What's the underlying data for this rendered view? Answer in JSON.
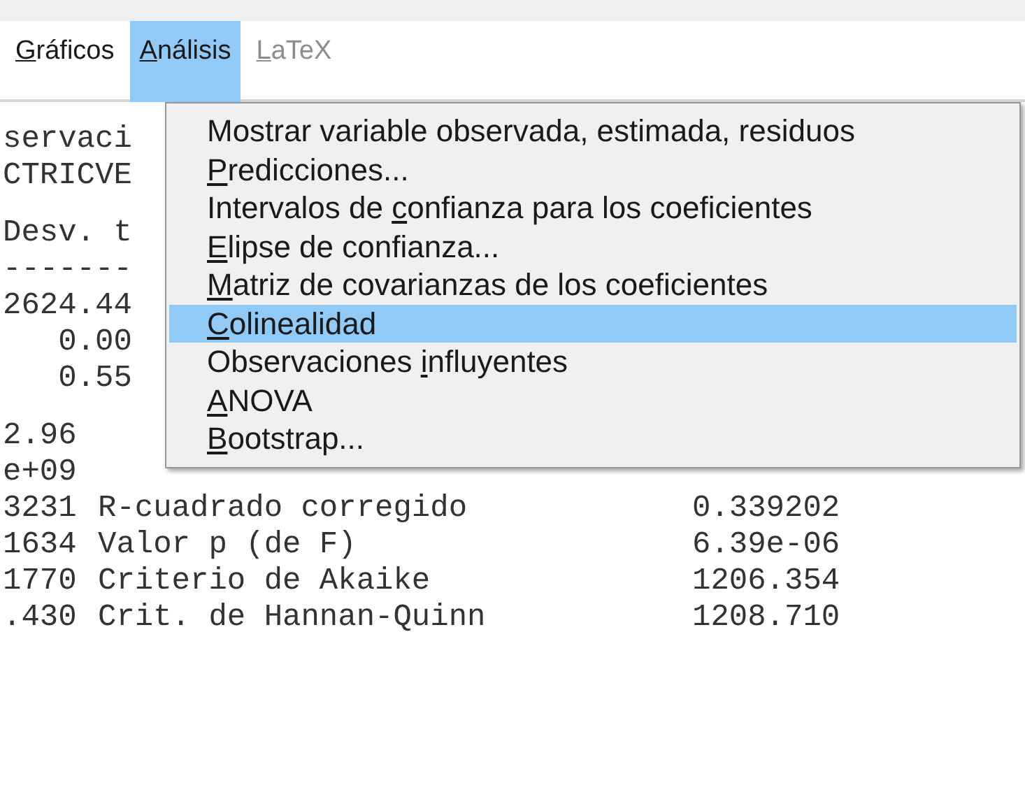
{
  "menubar": [
    {
      "label": {
        "key": "G",
        "after": "ráficos"
      },
      "selected": false,
      "disabled": false
    },
    {
      "label": {
        "key": "A",
        "after": "nálisis"
      },
      "selected": true,
      "disabled": false
    },
    {
      "label": {
        "key": "L",
        "after": "aTeX"
      },
      "selected": false,
      "disabled": true
    }
  ],
  "output": {
    "blocks": [
      {
        "lines": [
          "servaci",
          "CTRICVE"
        ]
      },
      {
        "lines": [
          "Desv. t",
          "-------",
          "2624.44",
          "   0.00",
          "   0.55"
        ]
      },
      {
        "lines": [
          "2.96",
          "e+09"
        ]
      }
    ],
    "rows": [
      {
        "col_1": "3231",
        "col_2": "R-cuadrado corregido",
        "col_3": "0.339202"
      },
      {
        "col_1": "1634",
        "col_2": "Valor p (de F)",
        "col_3": "6.39e-06"
      },
      {
        "col_1": "1770",
        "col_2": "Criterio de Akaike",
        "col_3": "1206.354"
      },
      {
        "col_1": ".430",
        "col_2": "Crit. de Hannan-Quinn",
        "col_3": "1208.710"
      }
    ]
  },
  "menu": {
    "items": [
      {
        "label": {
          "before": "Mostrar variable observada, estimada, residuos"
        },
        "selected": false
      },
      {
        "label": {
          "key": "P",
          "after": "redicciones..."
        },
        "selected": false
      },
      {
        "label": {
          "before": "Intervalos de ",
          "key": "c",
          "after": "onfianza para los coeficientes"
        },
        "selected": false
      },
      {
        "label": {
          "key": "E",
          "after": "lipse de confianza..."
        },
        "selected": false
      },
      {
        "label": {
          "key": "M",
          "after": "atriz de covarianzas de los coeficientes"
        },
        "selected": false
      },
      {
        "label": {
          "key": "C",
          "after": "olinealidad"
        },
        "selected": true
      },
      {
        "label": {
          "before": "Observaciones ",
          "key": "i",
          "after": "nfluyentes"
        },
        "selected": false
      },
      {
        "label": {
          "key": "A",
          "after": "NOVA"
        },
        "selected": false
      },
      {
        "label": {
          "key": "B",
          "after": "ootstrap..."
        },
        "selected": false
      }
    ]
  }
}
